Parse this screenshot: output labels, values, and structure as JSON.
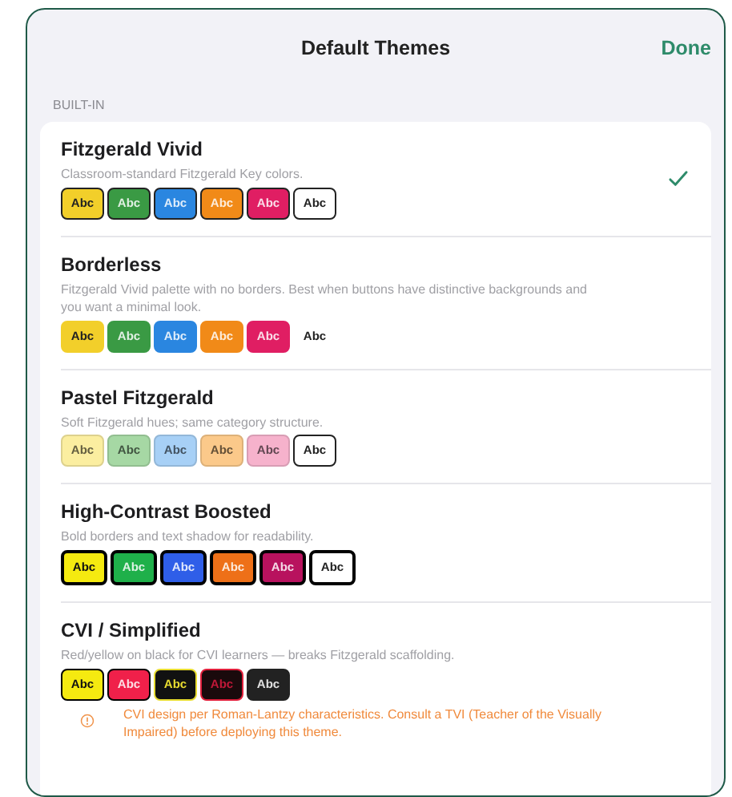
{
  "header": {
    "title": "Default Themes",
    "done_button": "Done"
  },
  "section": {
    "title": "BUILT-IN"
  },
  "themes": [
    {
      "name": "Fitzgerald Vivid",
      "kind": "vivid",
      "description": "Classroom-standard Fitzgerald Key colors.",
      "selected": true,
      "swatches": [
        {
          "label": "Abc",
          "color": "#f2cf2a"
        },
        {
          "label": "Abc",
          "color": "#3a9a44"
        },
        {
          "label": "Abc",
          "color": "#2a86e0"
        },
        {
          "label": "Abc",
          "color": "#f18a18"
        },
        {
          "label": "Abc",
          "color": "#e01e63"
        },
        {
          "label": "Abc",
          "color": "#ffffff"
        }
      ]
    },
    {
      "name": "Borderless",
      "kind": "borderless",
      "description": "Fitzgerald Vivid palette with no borders. Best when buttons have distinctive backgrounds and you want a minimal look.",
      "selected": false,
      "swatches": [
        {
          "label": "Abc",
          "color": "#f2cf2a"
        },
        {
          "label": "Abc",
          "color": "#3a9a44"
        },
        {
          "label": "Abc",
          "color": "#2a86e0"
        },
        {
          "label": "Abc",
          "color": "#f18a18"
        },
        {
          "label": "Abc",
          "color": "#e01e63"
        },
        {
          "label": "Abc",
          "color": "#ffffff"
        }
      ]
    },
    {
      "name": "Pastel Fitzgerald",
      "kind": "pastel",
      "description": "Soft Fitzgerald hues; same category structure.",
      "selected": false,
      "swatches": [
        {
          "label": "Abc",
          "color": "#fbeea0"
        },
        {
          "label": "Abc",
          "color": "#a6d8a4"
        },
        {
          "label": "Abc",
          "color": "#a7d0f6"
        },
        {
          "label": "Abc",
          "color": "#fbc98a"
        },
        {
          "label": "Abc",
          "color": "#f6b2cc"
        },
        {
          "label": "Abc",
          "color": "#ffffff"
        }
      ]
    },
    {
      "name": "High-Contrast Boosted",
      "kind": "high_contrast",
      "description": "Bold borders and text shadow for readability.",
      "selected": false,
      "swatches": [
        {
          "label": "Abc",
          "color": "#f5ea10"
        },
        {
          "label": "Abc",
          "color": "#1fb04a"
        },
        {
          "label": "Abc",
          "color": "#2f5ee8"
        },
        {
          "label": "Abc",
          "color": "#ee7018"
        },
        {
          "label": "Abc",
          "color": "#b8125e"
        },
        {
          "label": "Abc",
          "color": "#ffffff"
        }
      ]
    },
    {
      "name": "CVI / Simplified",
      "kind": "cvi",
      "description": "Red/yellow on black for CVI learners — breaks Fitzgerald scaffolding.",
      "selected": false,
      "swatches": [
        {
          "label": "Abc",
          "color": "#f5ea10"
        },
        {
          "label": "Abc",
          "color": "#f0204a"
        },
        {
          "label": "Abc",
          "color": "#111111"
        },
        {
          "label": "Abc",
          "color": "#1a0a0c"
        },
        {
          "label": "Abc",
          "color": "#222222"
        }
      ],
      "warning": "CVI design per Roman-Lantzy characteristics. Consult a TVI (Teacher of the Visually Impaired) before deploying this theme."
    }
  ]
}
